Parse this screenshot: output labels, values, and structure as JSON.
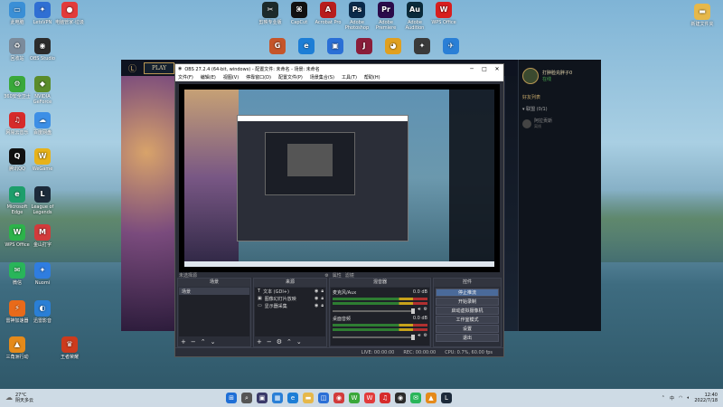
{
  "desktop": {
    "left_icons": [
      {
        "label": "此电脑",
        "color": "#3a8fd6",
        "glyph": "▭"
      },
      {
        "label": "LetsVPN",
        "color": "#2f6fd3",
        "glyph": "✦"
      },
      {
        "label": "电脑管家-垃圾",
        "color": "#e23b3b",
        "glyph": "●"
      },
      {
        "label": "回收站",
        "color": "#7b8b9b",
        "glyph": "♻"
      },
      {
        "label": "OBS Studio",
        "color": "#2c2c2c",
        "glyph": "◉"
      },
      {
        "label": "360安全卫士",
        "color": "#3aa83a",
        "glyph": "⚙"
      },
      {
        "label": "NVIDIA GeForce",
        "color": "#5b8c2a",
        "glyph": "◆"
      },
      {
        "label": "网易云音乐",
        "color": "#d62b2b",
        "glyph": "♫"
      },
      {
        "label": "百度网盘",
        "color": "#3d8fe6",
        "glyph": "☁"
      },
      {
        "label": "腾讯QQ",
        "color": "#111",
        "glyph": "Q"
      },
      {
        "label": "WeGame",
        "color": "#e7b21a",
        "glyph": "W"
      },
      {
        "label": "Microsoft Edge",
        "color": "#1d9e6b",
        "glyph": "e"
      },
      {
        "label": "League of Legends",
        "color": "#1c2a3a",
        "glyph": "L"
      },
      {
        "label": "WPS Office",
        "color": "#2cb34a",
        "glyph": "W"
      },
      {
        "label": "金山打字",
        "color": "#d23b3b",
        "glyph": "M"
      },
      {
        "label": "微信",
        "color": "#29b55a",
        "glyph": "✉"
      },
      {
        "label": "Nuomi",
        "color": "#2f7de0",
        "glyph": "✦"
      },
      {
        "label": "雷神加速器",
        "color": "#e86a1a",
        "glyph": "⚡"
      },
      {
        "label": "迅雷影音",
        "color": "#2a7fd6",
        "glyph": "◐"
      },
      {
        "label": "三角洲行动",
        "color": "#e58a1a",
        "glyph": "▲"
      },
      {
        "label": "王者荣耀",
        "color": "#cc3b1d",
        "glyph": "♛"
      }
    ],
    "top_icons": [
      {
        "label": "剪映专业版",
        "color": "#1c2a2a",
        "glyph": "✂"
      },
      {
        "label": "CapCut",
        "color": "#111",
        "glyph": "⌘"
      },
      {
        "label": "Acrobat Pro",
        "color": "#b81d1d",
        "glyph": "A"
      },
      {
        "label": "Adobe Photoshop",
        "color": "#0a2a4a",
        "glyph": "Ps"
      },
      {
        "label": "Adobe Premiere",
        "color": "#2a0a4a",
        "glyph": "Pr"
      },
      {
        "label": "Adobe Audition",
        "color": "#0a2a3a",
        "glyph": "Au"
      },
      {
        "label": "WPS Office",
        "color": "#d81e1e",
        "glyph": "W"
      }
    ],
    "second_row_icons": [
      {
        "color": "#c5552a",
        "glyph": "G"
      },
      {
        "color": "#1d7ed6",
        "glyph": "e"
      },
      {
        "color": "#2a6fd6",
        "glyph": "▣"
      },
      {
        "color": "#8a1d3a",
        "glyph": "J"
      },
      {
        "color": "#e0a020",
        "glyph": "◕"
      },
      {
        "color": "#3a3a3a",
        "glyph": "✦"
      },
      {
        "color": "#2a7fd6",
        "glyph": "✈"
      }
    ],
    "right_icon": {
      "label": "新建文件夹",
      "color": "#e6b84a",
      "glyph": "▬"
    }
  },
  "game": {
    "play_label": "PLAY",
    "social": {
      "username": "打肿脸充胖子0",
      "status": "在线",
      "friends_title": "好友列表",
      "group_label": "▾ 联盟 (0/1)",
      "friend_name": "阿拉贡斯",
      "friend_status": "离线"
    }
  },
  "obs": {
    "title": "OBS 27.2.4 (64-bit, windows) - 配置文件: 未命名 - 场景: 未命名",
    "menu": [
      "文件(F)",
      "编辑(E)",
      "视图(V)",
      "停靠窗口(D)",
      "配置文件(P)",
      "场景集合(S)",
      "工具(T)",
      "帮助(H)"
    ],
    "preview_toolbar": {
      "properties": "属性",
      "filters": "滤镜"
    },
    "scene_dock_title": "场景",
    "scenes": [
      "场景"
    ],
    "sources_dock_title": "来源",
    "sources": [
      "文本 (GDI+)",
      "图像幻灯片放映",
      "显示器采集"
    ],
    "no_source_label": "未选择源",
    "mixer_title": "混音器",
    "mixer_channels": [
      {
        "name": "麦克风/Aux",
        "db": "0.0 dB"
      },
      {
        "name": "桌面音频",
        "db": "0.0 dB"
      }
    ],
    "controls_title": "控件",
    "controls": [
      "停止推流",
      "开始录制",
      "启动虚拟摄像机",
      "工作室模式",
      "设置",
      "退出"
    ],
    "status": {
      "live": "LIVE: 00:00:00",
      "rec": "REC: 00:00:00",
      "cpu": "CPU: 0.7%, 60.00 fps"
    }
  },
  "taskbar": {
    "weather_temp": "27°C",
    "weather_desc": "阴天多云",
    "time": "12:40",
    "date": "2022/7/18",
    "tray_lang": "中"
  }
}
